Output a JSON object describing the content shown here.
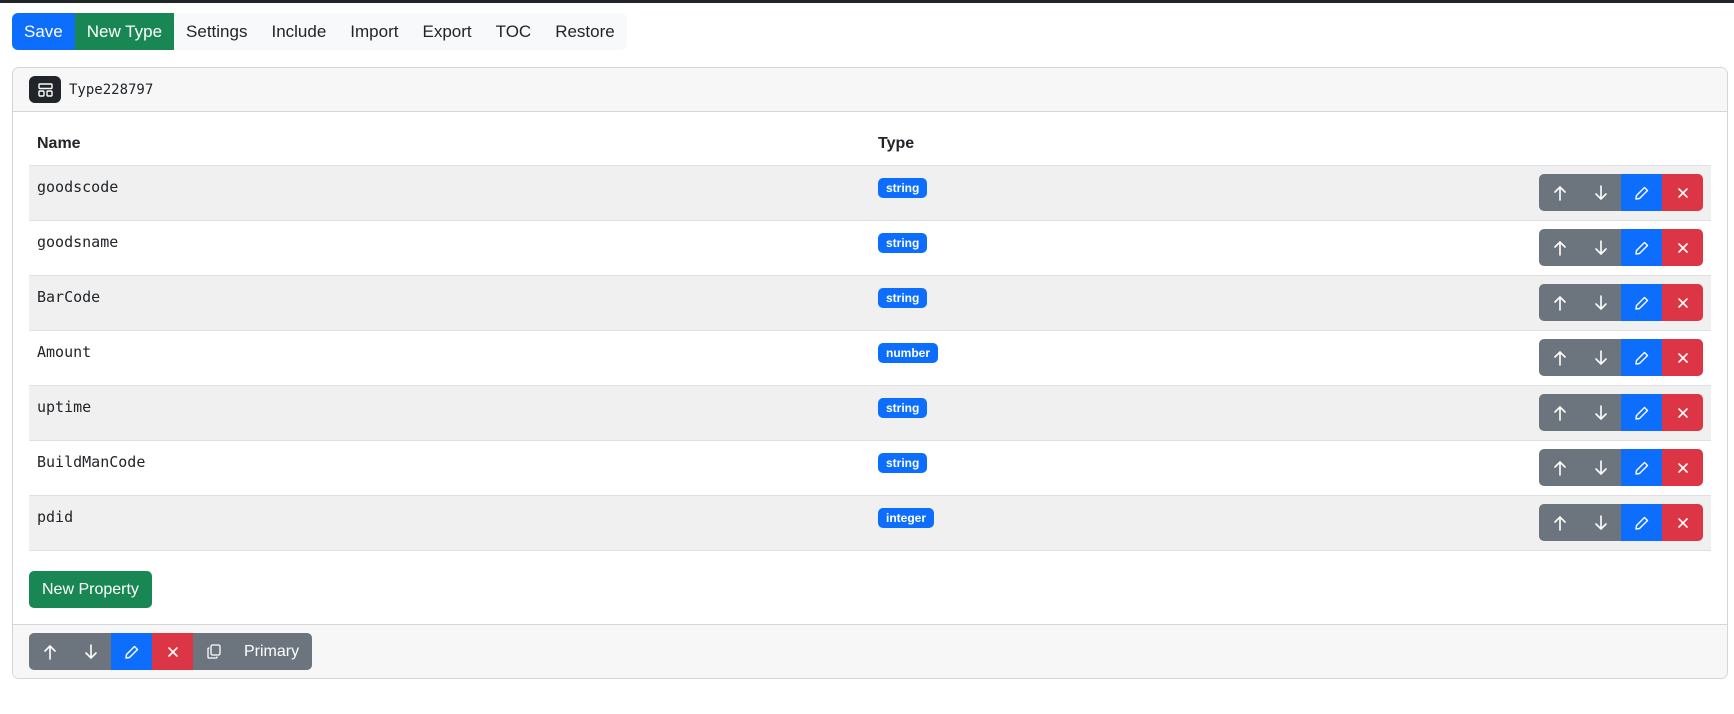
{
  "toolbar": {
    "items": [
      {
        "label": "Save",
        "style": "primary"
      },
      {
        "label": "New Type",
        "style": "success"
      },
      {
        "label": "Settings"
      },
      {
        "label": "Include"
      },
      {
        "label": "Import"
      },
      {
        "label": "Export"
      },
      {
        "label": "TOC"
      },
      {
        "label": "Restore"
      }
    ]
  },
  "type_card": {
    "icon": "layout-icon",
    "name": "Type228797",
    "columns": {
      "name": "Name",
      "type": "Type"
    },
    "properties": [
      {
        "name": "goodscode",
        "type": "string"
      },
      {
        "name": "goodsname",
        "type": "string"
      },
      {
        "name": "BarCode",
        "type": "string"
      },
      {
        "name": "Amount",
        "type": "number"
      },
      {
        "name": "uptime",
        "type": "string"
      },
      {
        "name": "BuildManCode",
        "type": "string"
      },
      {
        "name": "pdid",
        "type": "integer"
      }
    ],
    "new_property_label": "New Property",
    "footer": {
      "primary_label": "Primary"
    }
  },
  "colors": {
    "primary": "#0d6efd",
    "success": "#198754",
    "secondary": "#6c757d",
    "danger": "#dc3545",
    "dark": "#212529"
  }
}
